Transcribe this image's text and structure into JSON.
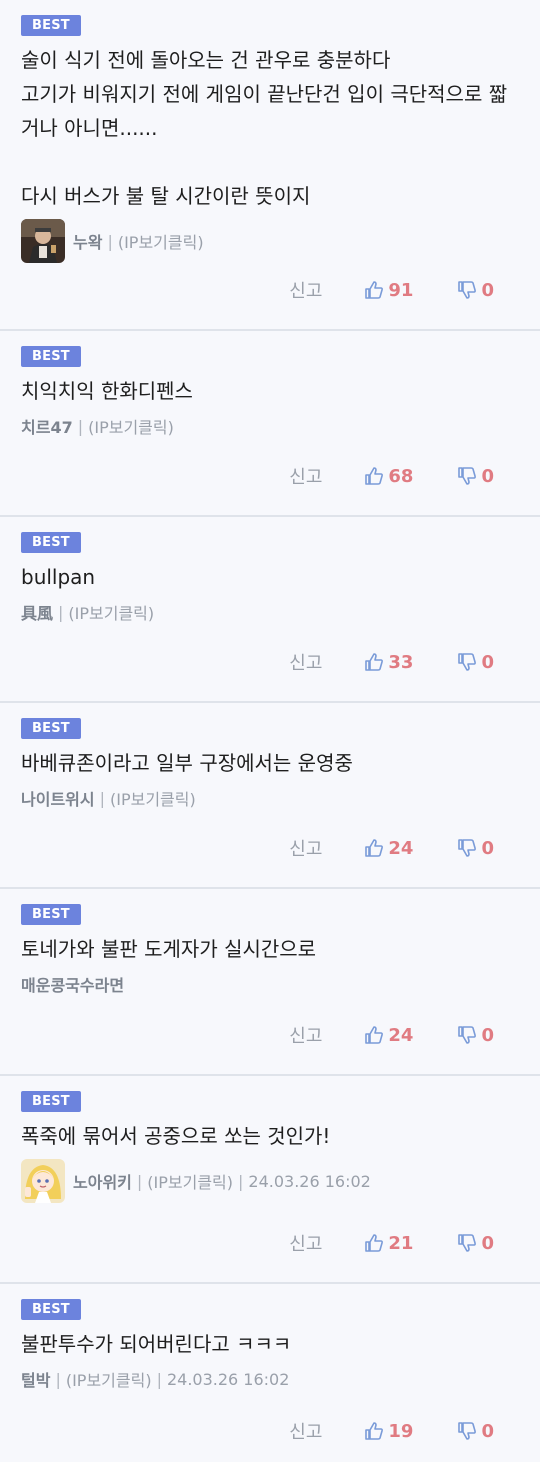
{
  "best_label": "BEST",
  "report_label": "신고",
  "comments": [
    {
      "text": "술이 식기 전에 돌아오는 건 관우로 충분하다\n고기가 비워지기 전에 게임이 끝난단건 입이 극단적으로 짧거나 아니면......\n\n다시 버스가 불 탈 시간이란 뜻이지",
      "author": "누왁",
      "ip": "(IP보기클릭)",
      "date": "",
      "likes": "91",
      "dislikes": "0"
    },
    {
      "text": "치익치익 한화디펜스",
      "author": "치르47",
      "ip": "(IP보기클릭)",
      "date": "",
      "likes": "68",
      "dislikes": "0"
    },
    {
      "text": "bullpan",
      "author": "具風",
      "ip": "(IP보기클릭)",
      "date": "",
      "likes": "33",
      "dislikes": "0"
    },
    {
      "text": "바베큐존이라고 일부 구장에서는 운영중",
      "author": "나이트위시",
      "ip": "(IP보기클릭)",
      "date": "",
      "likes": "24",
      "dislikes": "0"
    },
    {
      "text": "토네가와 불판 도게자가 실시간으로",
      "author": "매운콩국수라면",
      "ip": "",
      "date": "",
      "likes": "24",
      "dislikes": "0"
    },
    {
      "text": "폭죽에 묶어서 공중으로 쏘는 것인가!",
      "author": "노아위키",
      "ip": "(IP보기클릭)",
      "date": "24.03.26 16:02",
      "likes": "21",
      "dislikes": "0"
    },
    {
      "text": "불판투수가 되어버린다고 ㅋㅋㅋ",
      "author": "털박",
      "ip": "(IP보기클릭)",
      "date": "24.03.26 16:02",
      "likes": "19",
      "dislikes": "0"
    }
  ]
}
